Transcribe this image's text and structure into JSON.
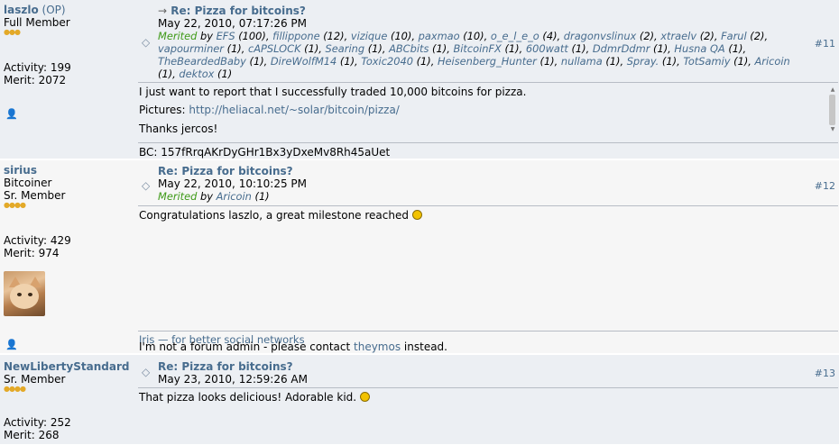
{
  "posts": [
    {
      "author": "laszlo",
      "author_suffix": "(OP)",
      "rank": "Full Member",
      "stars": "●●●",
      "activity": "Activity: 199",
      "merit": "Merit: 2072",
      "subject_prefix": "→",
      "subject": "Re: Pizza for bitcoins?",
      "date": "May 22, 2010, 07:17:26 PM",
      "merited_label": "Merited",
      "merited_by_word": "by",
      "merits": [
        {
          "name": "EFS",
          "count": "(100)"
        },
        {
          "name": "fillippone",
          "count": "(12)"
        },
        {
          "name": "vizique",
          "count": "(10)"
        },
        {
          "name": "paxmao",
          "count": "(10)"
        },
        {
          "name": "o_e_l_e_o",
          "count": "(4)"
        },
        {
          "name": "dragonvslinux",
          "count": "(2)"
        },
        {
          "name": "xtraelv",
          "count": "(2)"
        },
        {
          "name": "Farul",
          "count": "(2)"
        },
        {
          "name": "vapourminer",
          "count": "(1)"
        },
        {
          "name": "cAPSLOCK",
          "count": "(1)"
        },
        {
          "name": "Searing",
          "count": "(1)"
        },
        {
          "name": "ABCbits",
          "count": "(1)"
        },
        {
          "name": "BitcoinFX",
          "count": "(1)"
        },
        {
          "name": "600watt",
          "count": "(1)"
        },
        {
          "name": "DdmrDdmr",
          "count": "(1)"
        },
        {
          "name": "Husna QA",
          "count": "(1)"
        },
        {
          "name": "TheBeardedBaby",
          "count": "(1)"
        },
        {
          "name": "DireWolfM14",
          "count": "(1)"
        },
        {
          "name": "Toxic2040",
          "count": "(1)"
        },
        {
          "name": "Heisenberg_Hunter",
          "count": "(1)"
        },
        {
          "name": "nullama",
          "count": "(1)"
        },
        {
          "name": "Spray.",
          "count": "(1)"
        },
        {
          "name": "TotSamiy",
          "count": "(1)"
        },
        {
          "name": "Aricoin",
          "count": "(1)"
        },
        {
          "name": "dektox",
          "count": "(1)"
        }
      ],
      "post_number": "#11",
      "body_line1": "I just want to report that I successfully traded 10,000 bitcoins for pizza.",
      "pictures_label": "Pictures:",
      "pictures_link": "http://heliacal.net/~solar/bitcoin/pizza/",
      "thanks": "Thanks jercos!",
      "signature": "BC: 157fRrqAKrDyGHr1Bx3yDxeMv8Rh45aUet"
    },
    {
      "author": "sirius",
      "title": "Bitcoiner",
      "rank": "Sr. Member",
      "stars": "●●●●",
      "activity": "Activity: 429",
      "merit": "Merit: 974",
      "subject": "Re: Pizza for bitcoins?",
      "date": "May 22, 2010, 10:10:25 PM",
      "merited_label": "Merited",
      "merited_by_word": "by",
      "merits": [
        {
          "name": "Aricoin",
          "count": "(1)"
        }
      ],
      "post_number": "#12",
      "body": "Congratulations laszlo, a great milestone reached",
      "sig_link": "Iris — for better social networks",
      "sig_text_pre": "I'm not a forum admin - please contact",
      "sig_link2": "theymos",
      "sig_text_post": "instead."
    },
    {
      "author": "NewLibertyStandard",
      "rank": "Sr. Member",
      "stars": "●●●●",
      "activity": "Activity: 252",
      "merit": "Merit: 268",
      "subject": "Re: Pizza for bitcoins?",
      "date": "May 23, 2010, 12:59:26 AM",
      "post_number": "#13",
      "body": "That pizza looks delicious! Adorable kid."
    }
  ],
  "icons": {
    "subject": "◇",
    "person": "👤",
    "scroll_up": "▲",
    "scroll_down": "▼"
  }
}
